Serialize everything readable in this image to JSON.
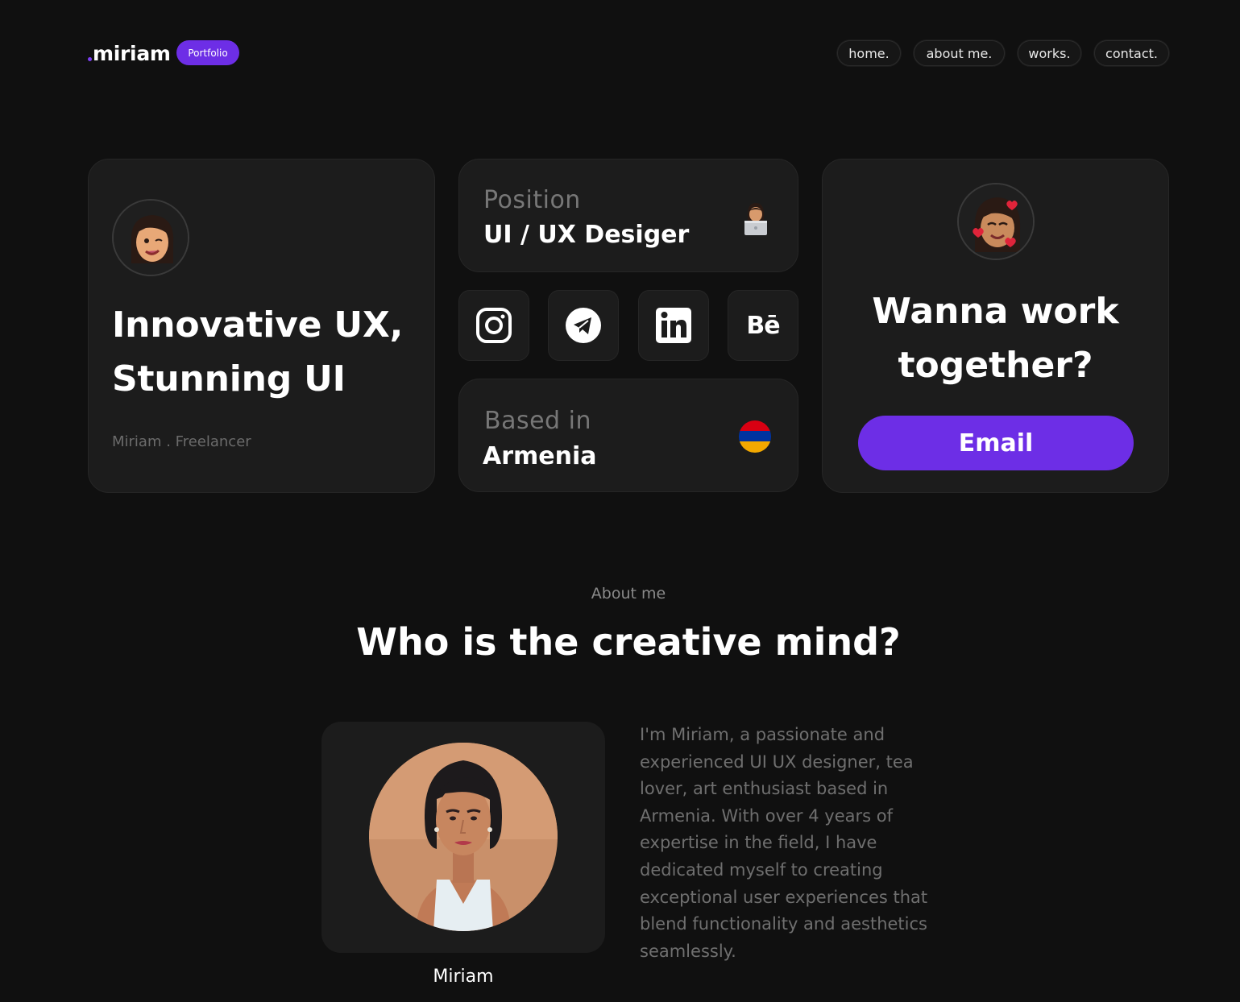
{
  "header": {
    "logo_text": "miriam",
    "badge": "Portfolio",
    "nav": [
      {
        "label": "home."
      },
      {
        "label": "about me."
      },
      {
        "label": "works."
      },
      {
        "label": "contact."
      }
    ]
  },
  "hero": {
    "title_line1": "Innovative UX,",
    "title_line2": "Stunning UI",
    "subtitle": "Miriam . Freelancer"
  },
  "position": {
    "label": "Position",
    "value": "UI / UX Desiger"
  },
  "socials": [
    {
      "icon": "instagram-icon"
    },
    {
      "icon": "telegram-icon"
    },
    {
      "icon": "linkedin-icon",
      "glyph": "in"
    },
    {
      "icon": "behance-icon",
      "glyph": "Bē"
    }
  ],
  "location": {
    "label": "Based in",
    "value": "Armenia"
  },
  "cta": {
    "title_line1": "Wanna work",
    "title_line2": "together?",
    "button": "Email"
  },
  "about": {
    "kicker": "About me",
    "title": "Who is the creative mind?",
    "name": "Miriam",
    "text": "I'm Miriam, a passionate and experienced UI UX designer, tea lover, art enthusiast based in Armenia. With over 4 years of expertise in the field, I have dedicated myself to creating exceptional user experiences that blend functionality and aesthetics seamlessly."
  },
  "colors": {
    "background": "#101010",
    "card": "#1c1c1c",
    "accent": "#6d2ee6",
    "flag": [
      "#d90012",
      "#0033a0",
      "#f2a800"
    ]
  }
}
